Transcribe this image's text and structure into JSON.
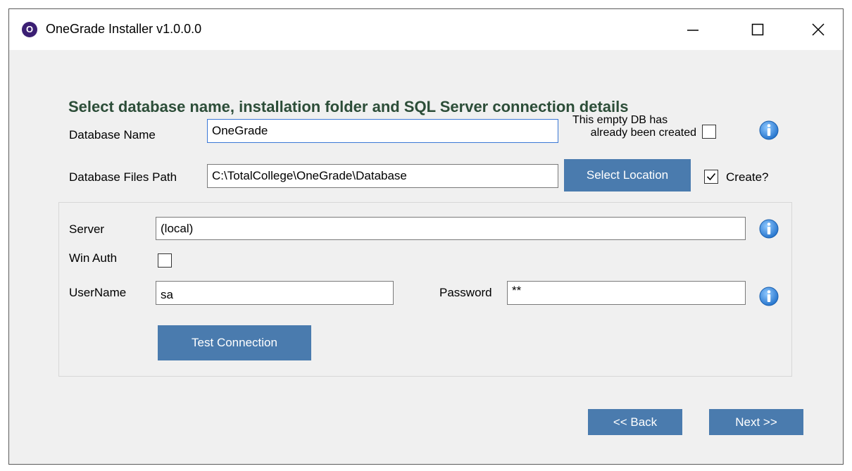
{
  "window": {
    "title": "OneGrade Installer v1.0.0.0",
    "icon_letter": "O",
    "icon_color": "#3b1f73",
    "controls": [
      "minimize-icon",
      "maximize-icon",
      "close-icon"
    ]
  },
  "heading": "Select database name, installation folder and SQL Server connection details",
  "database": {
    "name_label": "Database Name",
    "name_value": "OneGrade",
    "empty_db_label_line1": "This empty DB has",
    "empty_db_label_line2": "already been created",
    "empty_db_checked": false,
    "path_label": "Database Files Path",
    "path_value": "C:\\TotalCollege\\OneGrade\\Database",
    "select_location_label": "Select Location",
    "create_label": "Create?",
    "create_checked": true
  },
  "connection": {
    "server_label": "Server",
    "server_value": "(local)",
    "win_auth_label": "Win Auth",
    "win_auth_checked": false,
    "username_label": "UserName",
    "username_value": "sa",
    "password_label": "Password",
    "password_value": "**",
    "test_connection_label": "Test Connection"
  },
  "footer": {
    "back_label": "<< Back",
    "next_label": "Next >>"
  },
  "colors": {
    "accent_button": "#4a7bae",
    "heading": "#2c4d38",
    "info_icon": "#2a7fd4"
  }
}
